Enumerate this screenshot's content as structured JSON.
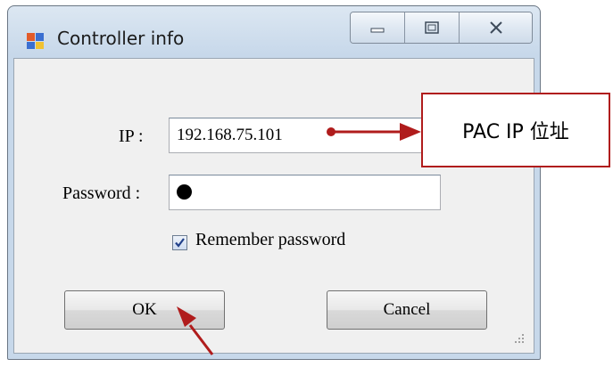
{
  "window": {
    "title": "Controller info",
    "app_icon": "window-app-icon"
  },
  "caption": {
    "minimize_icon": "minimize-icon",
    "maximize_icon": "maximize-icon",
    "close_icon": "close-icon"
  },
  "form": {
    "ip_label": "IP :",
    "ip_value": "192.168.75.101",
    "password_label": "Password :",
    "password_masked": "●",
    "remember_label": "Remember password",
    "remember_checked": true
  },
  "buttons": {
    "ok": "OK",
    "cancel": "Cancel"
  },
  "annotation": {
    "callout_text": "PAC IP 位址",
    "accent_color": "#b01c1c"
  }
}
